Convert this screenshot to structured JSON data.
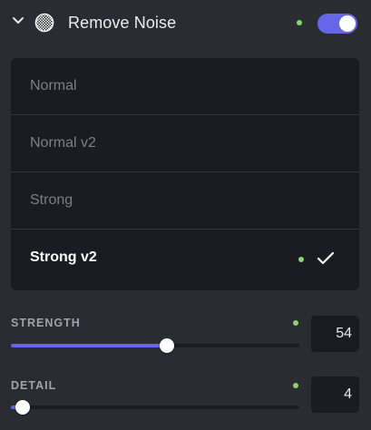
{
  "header": {
    "title": "Remove Noise",
    "enabled": true,
    "collapse_icon": "chevron-down-icon",
    "feature_icon": "noise-checker-icon",
    "status_dot_color": "#86d86e"
  },
  "options": [
    {
      "label": "Normal",
      "selected": false
    },
    {
      "label": "Normal v2",
      "selected": false
    },
    {
      "label": "Strong",
      "selected": false
    },
    {
      "label": "Strong v2",
      "selected": true
    }
  ],
  "sliders": {
    "strength": {
      "label": "STRENGTH",
      "value": "54",
      "max": 100
    },
    "detail": {
      "label": "DETAIL",
      "value": "4",
      "max": 100
    }
  },
  "colors": {
    "accent": "#6566e8",
    "status_green": "#86d86e",
    "panel_bg": "#2b2c31",
    "list_bg": "#1a1c21"
  }
}
